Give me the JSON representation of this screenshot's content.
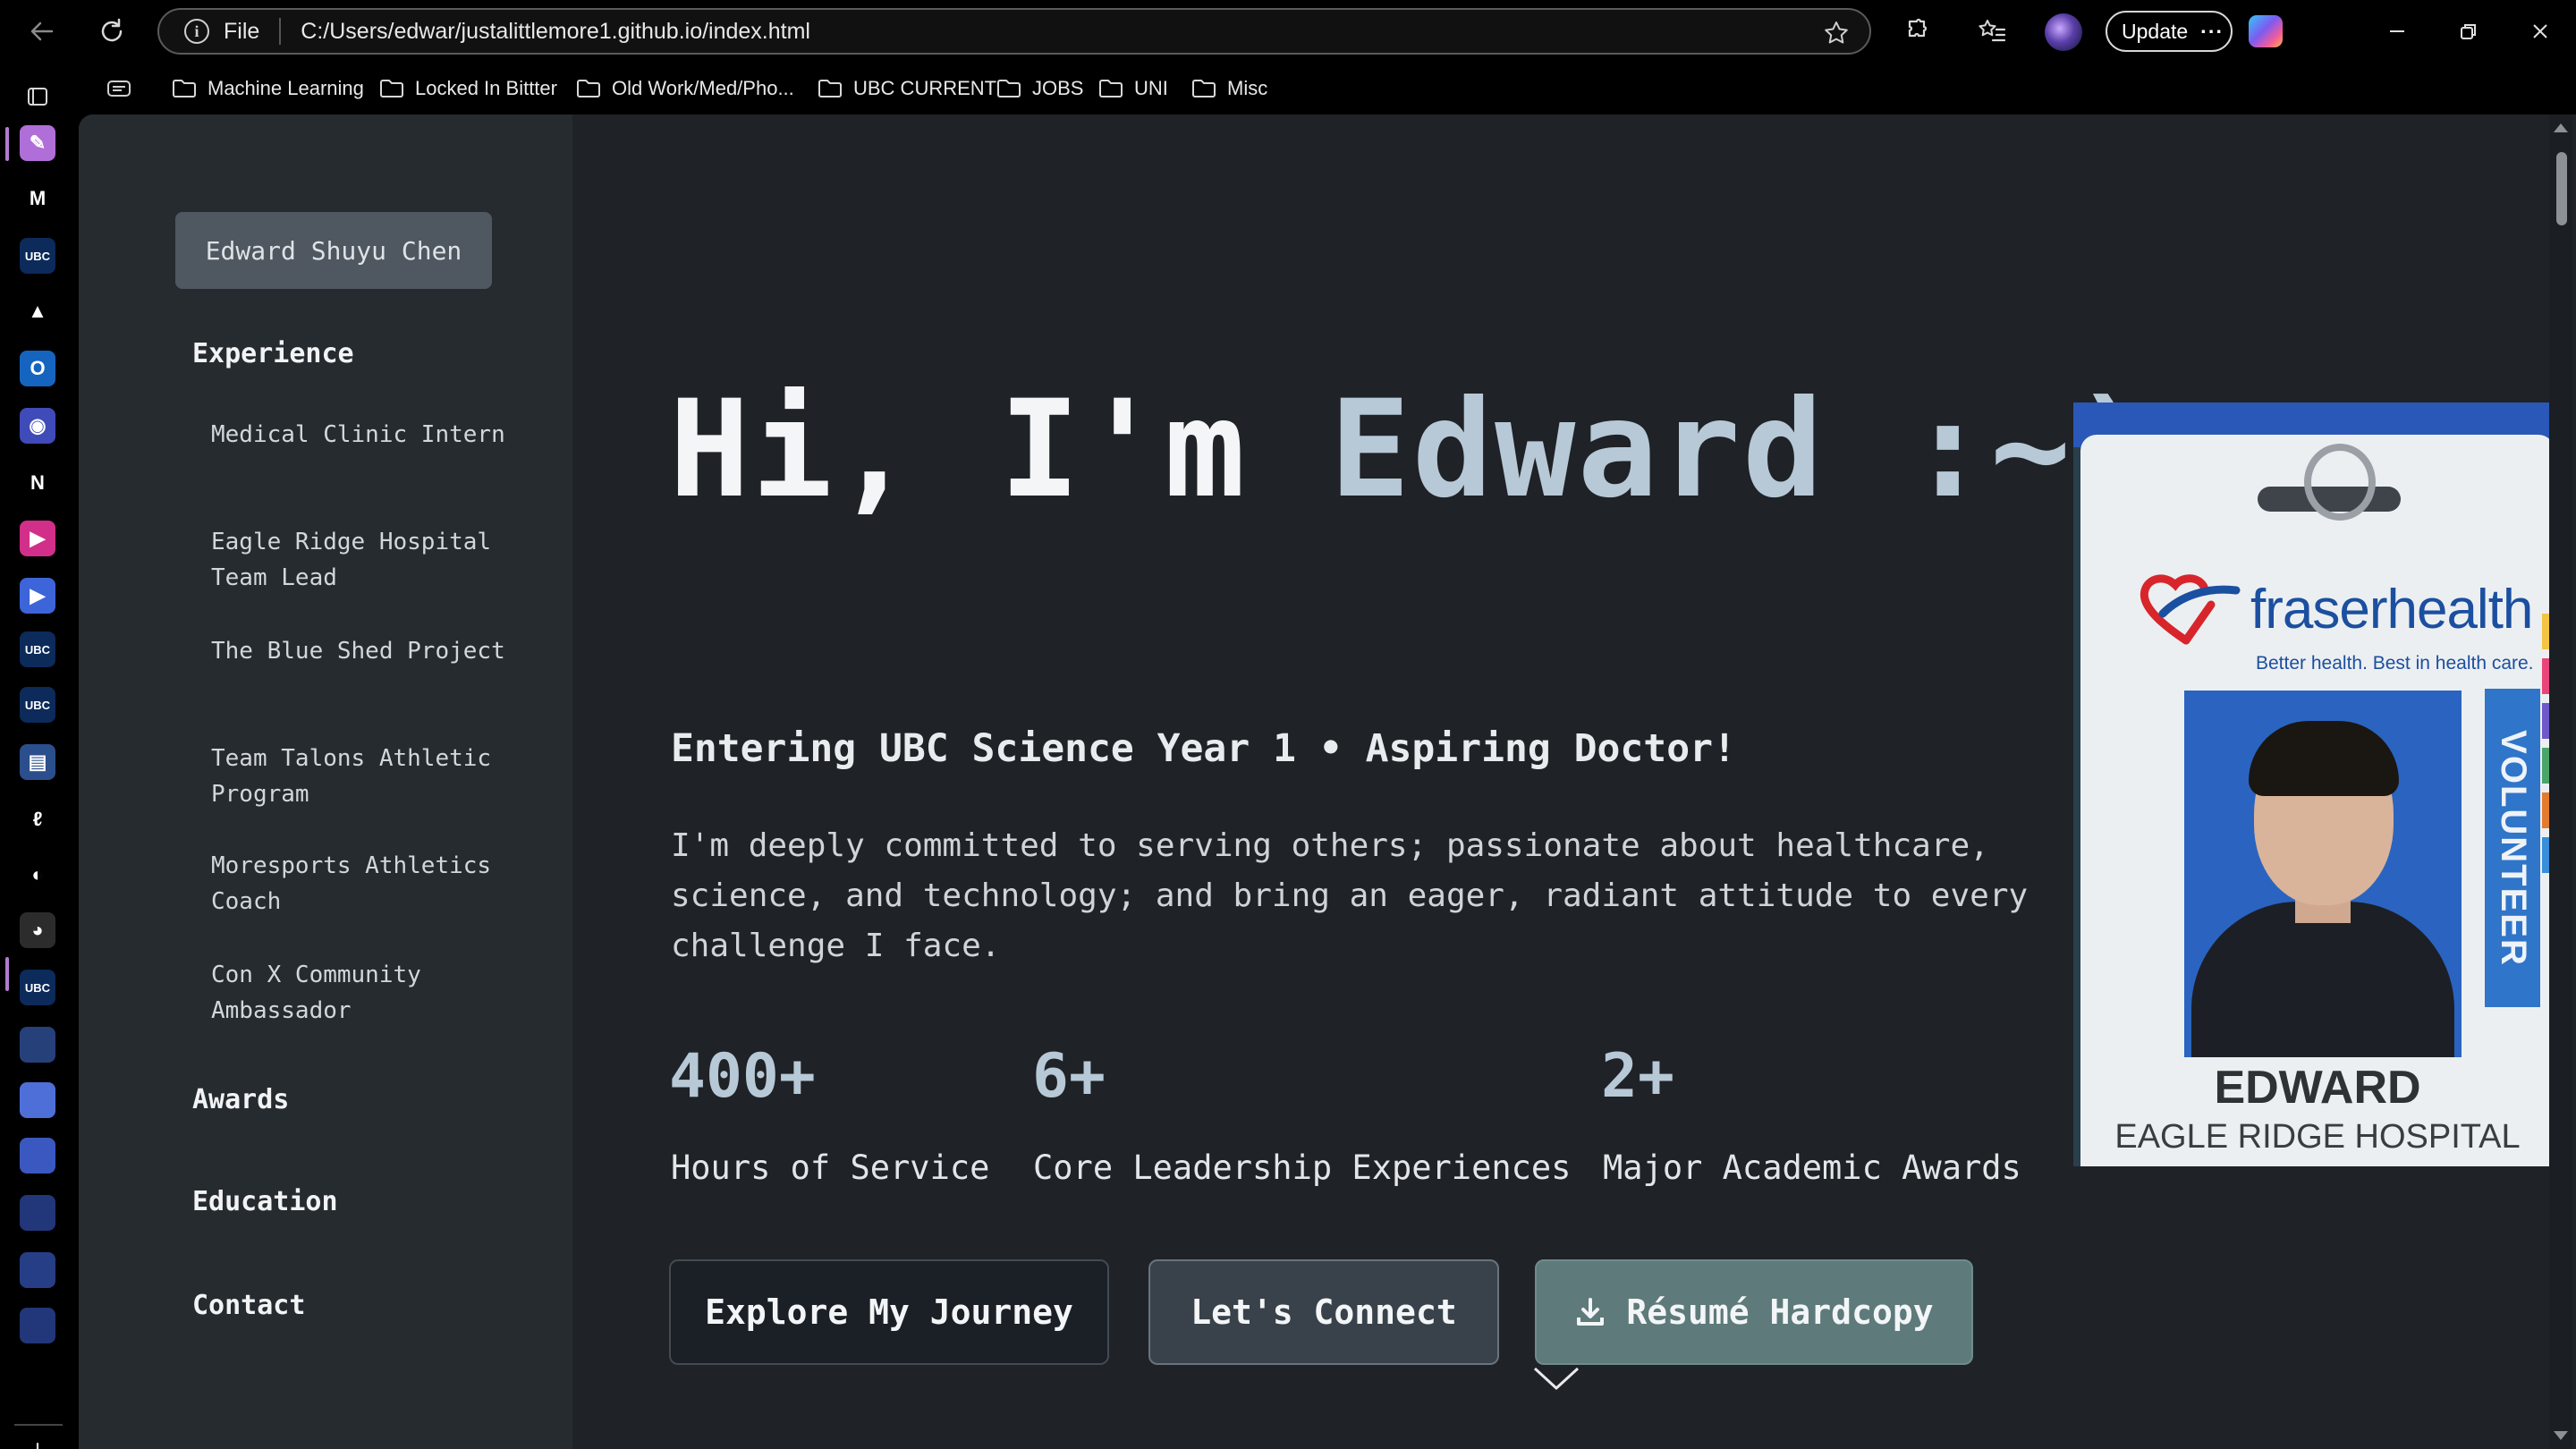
{
  "browser": {
    "address": {
      "scheme": "File",
      "url": "C:/Users/edwar/justalittlemore1.github.io/index.html"
    },
    "update_label": "Update",
    "update_more": "···",
    "bookmarks": [
      {
        "label": "Machine Learning"
      },
      {
        "label": "Locked In Bittter"
      },
      {
        "label": "Old Work/Med/Pho..."
      },
      {
        "label": "UBC CURRENT"
      },
      {
        "label": "JOBS"
      },
      {
        "label": "UNI"
      },
      {
        "label": "Misc"
      }
    ],
    "sidebar_apps": [
      {
        "name": "pen-icon",
        "color": "#b06fd8",
        "glyph": "✎"
      },
      {
        "name": "gmail-icon",
        "color": "#000000",
        "glyph": "M"
      },
      {
        "name": "ubc-icon",
        "color": "#0c2a5a",
        "glyph": "UBC"
      },
      {
        "name": "drive-icon",
        "color": "#000000",
        "glyph": "▲"
      },
      {
        "name": "outlook-icon",
        "color": "#1565c0",
        "glyph": "O"
      },
      {
        "name": "discord-icon",
        "color": "#3f4bb8",
        "glyph": "◉"
      },
      {
        "name": "notion-icon",
        "color": "#000000",
        "glyph": "N"
      },
      {
        "name": "video-icon",
        "color": "#d12f8a",
        "glyph": "▶"
      },
      {
        "name": "player-icon",
        "color": "#3d64d8",
        "glyph": "▶"
      },
      {
        "name": "ubc-icon",
        "color": "#0c2a5a",
        "glyph": "UBC"
      },
      {
        "name": "ubc-icon",
        "color": "#0c2a5a",
        "glyph": "UBC"
      },
      {
        "name": "docs-icon",
        "color": "#2b4f8c",
        "glyph": "▤"
      },
      {
        "name": "link-icon",
        "color": "#000000",
        "glyph": "ℓ"
      },
      {
        "name": "github-icon",
        "color": "#000000",
        "glyph": "◐"
      },
      {
        "name": "current-site-icon",
        "color": "#2c2c2c",
        "glyph": "◕"
      },
      {
        "name": "ubc-icon",
        "color": "#0c2a5a",
        "glyph": "UBC"
      },
      {
        "name": "tab-icon",
        "color": "#26407a",
        "glyph": ""
      },
      {
        "name": "tab-icon",
        "color": "#4f6fd8",
        "glyph": ""
      },
      {
        "name": "tab-icon",
        "color": "#3a58c0",
        "glyph": ""
      },
      {
        "name": "tab-icon",
        "color": "#22367a",
        "glyph": ""
      },
      {
        "name": "tab-icon",
        "color": "#263e86",
        "glyph": ""
      },
      {
        "name": "tab-icon",
        "color": "#22367a",
        "glyph": ""
      }
    ]
  },
  "site": {
    "nav": {
      "name_button": "Edward Shuyu Chen",
      "experience_label": "Experience",
      "experience_items": [
        {
          "label": "Medical Clinic Intern"
        },
        {
          "label": "Eagle Ridge Hospital Team Lead"
        },
        {
          "label": "The Blue Shed Project"
        },
        {
          "label": "Team Talons Athletic Program"
        },
        {
          "label": "Moresports Athletics Coach"
        },
        {
          "label": "Con X Community Ambassador"
        }
      ],
      "awards_label": "Awards",
      "education_label": "Education",
      "contact_label": "Contact"
    },
    "hero": {
      "greeting": "Hi, I'm",
      "name": "Edward :~)",
      "subtitle": "Entering UBC Science Year 1 • Aspiring Doctor!",
      "description": "I'm deeply committed to serving others; passionate about healthcare, science, and technology; and bring an eager, radiant attitude to every challenge I face."
    },
    "stats": [
      {
        "value": "400+",
        "label": "Hours of Service"
      },
      {
        "value": "6+",
        "label": "Core Leadership Experiences"
      },
      {
        "value": "2+",
        "label": "Major Academic Awards"
      }
    ],
    "buttons": {
      "explore": "Explore My Journey",
      "connect": "Let's Connect",
      "resume": "Résumé Hardcopy"
    },
    "badge": {
      "org_name": "fraserhealth",
      "tagline": "Better health. Best in health care.",
      "role": "VOLUNTEER",
      "person": "EDWARD",
      "site": "EAGLE RIDGE HOSPITAL"
    }
  }
}
